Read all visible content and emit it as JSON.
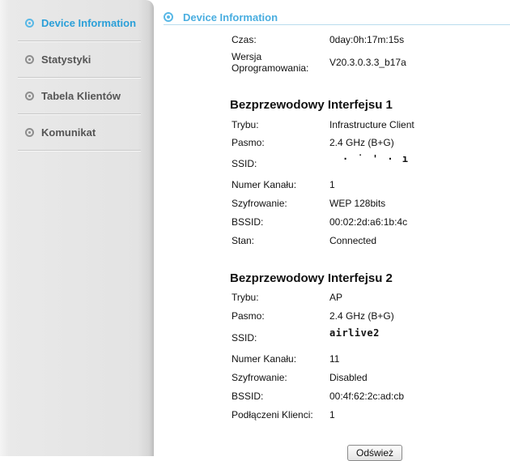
{
  "sidebar": {
    "items": [
      {
        "label": "Device Information",
        "active": true
      },
      {
        "label": "Statystyki"
      },
      {
        "label": "Tabela Klientów"
      },
      {
        "label": "Komunikat"
      }
    ]
  },
  "header": {
    "title": "Device Information"
  },
  "system": {
    "czas_label": "Czas:",
    "czas_value": "0day:0h:17m:15s",
    "wersja_label": "Wersja Oprogramowania:",
    "wersja_value": "V20.3.0.3.3_b17a"
  },
  "wireless1": {
    "title": "Bezprzewodowy Interfejsu 1",
    "trybu_label": "Trybu:",
    "trybu_value": "Infrastructure Client",
    "pasmo_label": "Pasmo:",
    "pasmo_value": "2.4 GHz (B+G)",
    "ssid_label": "SSID:",
    "ssid_value": "",
    "kanal_label": "Numer Kanału:",
    "kanal_value": "1",
    "szyfr_label": "Szyfrowanie:",
    "szyfr_value": "WEP 128bits",
    "bssid_label": "BSSID:",
    "bssid_value": "00:02:2d:a6:1b:4c",
    "stan_label": "Stan:",
    "stan_value": "Connected"
  },
  "wireless2": {
    "title": "Bezprzewodowy Interfejsu 2",
    "trybu_label": "Trybu:",
    "trybu_value": "AP",
    "pasmo_label": "Pasmo:",
    "pasmo_value": "2.4 GHz (B+G)",
    "ssid_label": "SSID:",
    "ssid_value": "airlive2",
    "kanal_label": "Numer Kanału:",
    "kanal_value": "11",
    "szyfr_label": "Szyfrowanie:",
    "szyfr_value": "Disabled",
    "bssid_label": "BSSID:",
    "bssid_value": "00:4f:62:2c:ad:cb",
    "klienci_label": "Podłączeni Klienci:",
    "klienci_value": "1"
  },
  "buttons": {
    "refresh": "Odśwież"
  },
  "colors": {
    "accent": "#4aaee0",
    "sidebar_bg": "#e3e3e3"
  }
}
